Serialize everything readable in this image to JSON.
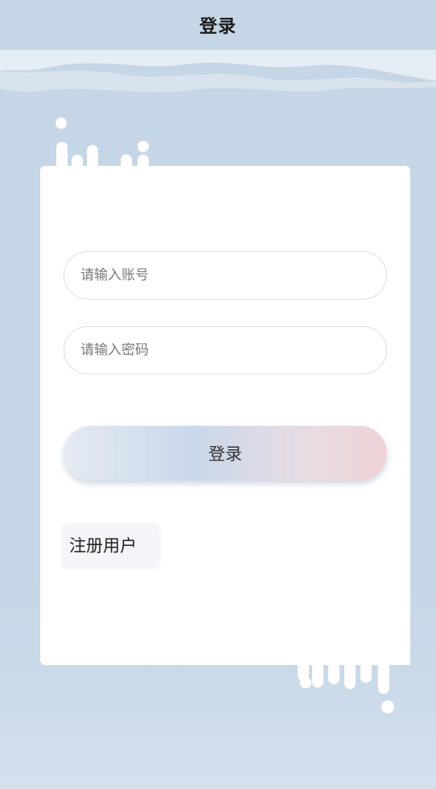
{
  "topbar": {
    "title": "登录"
  },
  "form": {
    "account_placeholder": "请输入账号",
    "password_placeholder": "请输入密码",
    "login_label": "登录",
    "register_label": "注册用户"
  },
  "colors": {
    "background": "#c5d6e6",
    "card": "#ffffff",
    "field_border": "#dcdfe6",
    "login_gradient_left": "#c9d7ea",
    "login_gradient_right": "#efd3d6"
  },
  "decorations": {
    "top_icon": "drip-decoration-icon",
    "bottom_icon": "drip-decoration-icon"
  }
}
